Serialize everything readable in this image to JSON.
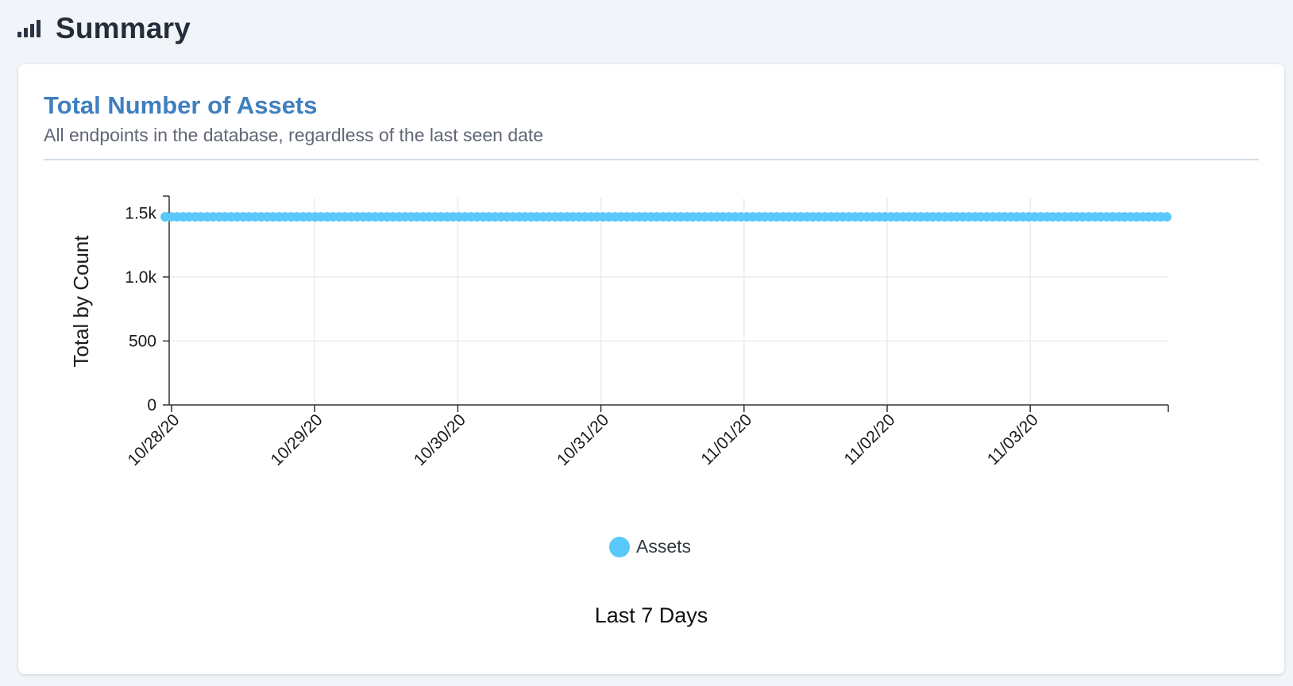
{
  "header": {
    "title": "Summary",
    "icon": "bar-chart-icon"
  },
  "card": {
    "title": "Total Number of Assets",
    "subtitle": "All endpoints in the database, regardless of the last seen date",
    "footer": "Last 7 Days"
  },
  "chart_data": {
    "type": "line",
    "title": "Total Number of Assets",
    "subtitle": "All endpoints in the database, regardless of the last seen date",
    "xlabel": "Last 7 Days",
    "ylabel": "Total by Count",
    "x_tick_labels": [
      "10/28/20",
      "10/29/20",
      "10/30/20",
      "10/31/20",
      "11/01/20",
      "11/02/20",
      "11/03/20"
    ],
    "y_ticks": [
      0,
      500,
      1000,
      1500
    ],
    "y_tick_labels": [
      "0",
      "500",
      "1.0k",
      "1.5k"
    ],
    "ylim": [
      0,
      1620
    ],
    "xlim": [
      "10/28/20",
      "11/03/20 23:00"
    ],
    "grid": true,
    "legend_position": "bottom-center",
    "series": [
      {
        "name": "Assets",
        "color": "#5ac8fa",
        "marker": "circle",
        "points_per_day": 24,
        "x_start": "10/28/20 00:00",
        "x_end": "11/03/20 23:00",
        "value": 1470
      }
    ]
  },
  "colors": {
    "accent": "#3f7fbf",
    "series": "#5ac8fa",
    "background": "#f1f4f8"
  }
}
